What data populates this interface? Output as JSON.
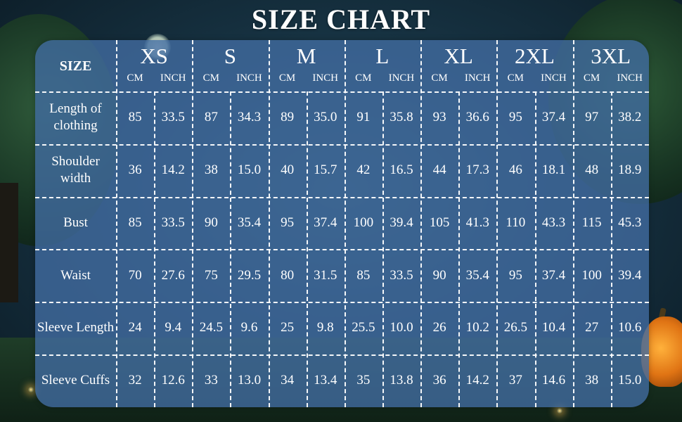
{
  "title": "SIZE CHART",
  "colors": {
    "panel": "#416ca0",
    "text": "#ffffff",
    "title": "#ffffff"
  },
  "table": {
    "corner_label": "SIZE",
    "sizes": [
      "XS",
      "S",
      "M",
      "L",
      "XL",
      "2XL",
      "3XL"
    ],
    "units": [
      "CM",
      "INCH"
    ],
    "rows": [
      {
        "label": "Length of clothing",
        "values": [
          "85",
          "33.5",
          "87",
          "34.3",
          "89",
          "35.0",
          "91",
          "35.8",
          "93",
          "36.6",
          "95",
          "37.4",
          "97",
          "38.2"
        ]
      },
      {
        "label": "Shoulder width",
        "values": [
          "36",
          "14.2",
          "38",
          "15.0",
          "40",
          "15.7",
          "42",
          "16.5",
          "44",
          "17.3",
          "46",
          "18.1",
          "48",
          "18.9"
        ]
      },
      {
        "label": "Bust",
        "values": [
          "85",
          "33.5",
          "90",
          "35.4",
          "95",
          "37.4",
          "100",
          "39.4",
          "105",
          "41.3",
          "110",
          "43.3",
          "115",
          "45.3"
        ]
      },
      {
        "label": "Waist",
        "values": [
          "70",
          "27.6",
          "75",
          "29.5",
          "80",
          "31.5",
          "85",
          "33.5",
          "90",
          "35.4",
          "95",
          "37.4",
          "100",
          "39.4"
        ]
      },
      {
        "label": "Sleeve Length",
        "values": [
          "24",
          "9.4",
          "24.5",
          "9.6",
          "25",
          "9.8",
          "25.5",
          "10.0",
          "26",
          "10.2",
          "26.5",
          "10.4",
          "27",
          "10.6"
        ]
      },
      {
        "label": "Sleeve Cuffs",
        "values": [
          "32",
          "12.6",
          "33",
          "13.0",
          "34",
          "13.4",
          "35",
          "13.8",
          "36",
          "14.2",
          "37",
          "14.6",
          "38",
          "15.0"
        ]
      }
    ]
  }
}
